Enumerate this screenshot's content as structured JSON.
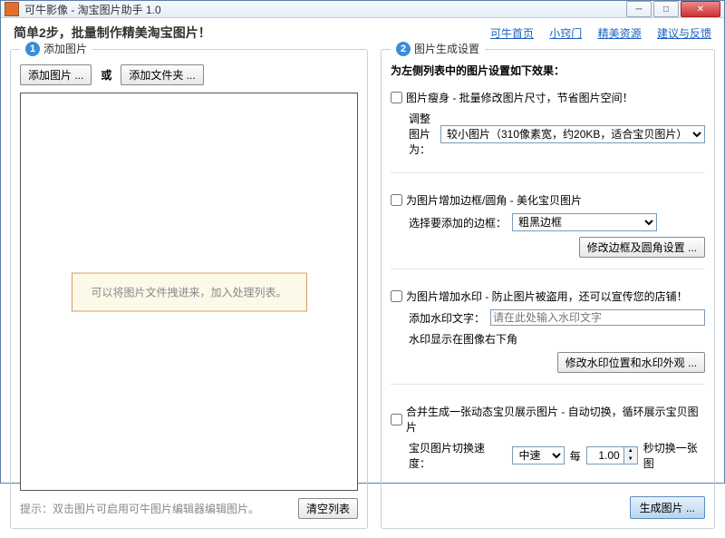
{
  "window": {
    "title": "可牛影像 - 淘宝图片助手 1.0"
  },
  "header": {
    "title": "简单2步，批量制作精美淘宝图片！",
    "links": [
      "可牛首页",
      "小窍门",
      "精美资源",
      "建议与反馈"
    ]
  },
  "left": {
    "heading": "添加图片",
    "add_images_btn": "添加图片 ...",
    "or": "或",
    "add_folder_btn": "添加文件夹 ...",
    "drop_hint": "可以将图片文件拽进来，加入处理列表。",
    "edit_hint": "提示：双击图片可启用可牛图片编辑器编辑图片。",
    "clear_btn": "清空列表"
  },
  "right": {
    "heading": "图片生成设置",
    "subtitle": "为左侧列表中的图片设置如下效果：",
    "resize": {
      "label": "图片瘦身 - 批量修改图片尺寸，节省图片空间！",
      "adjust_label": "调整图片为：",
      "option": "较小图片（310像素宽，约20KB，适合宝贝图片）"
    },
    "border": {
      "label": "为图片增加边框/圆角 - 美化宝贝图片",
      "select_label": "选择要添加的边框：",
      "option": "粗黑边框",
      "settings_btn": "修改边框及圆角设置 ..."
    },
    "watermark": {
      "label": "为图片增加水印 - 防止图片被盗用，还可以宣传您的店铺！",
      "text_label": "添加水印文字：",
      "text_placeholder": "请在此处输入水印文字",
      "position_note": "水印显示在图像右下角",
      "settings_btn": "修改水印位置和水印外观 ..."
    },
    "merge": {
      "label": "合并生成一张动态宝贝展示图片 - 自动切换，循环展示宝贝图片",
      "speed_label": "宝贝图片切换速度：",
      "speed_option": "中速",
      "every": "每",
      "interval": "1.00",
      "seconds_label": "秒切换一张图"
    },
    "generate_btn": "生成图片 ..."
  }
}
